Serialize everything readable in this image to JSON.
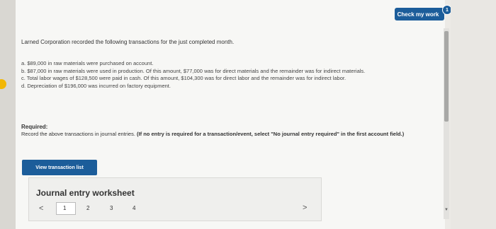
{
  "header": {
    "check_label": "Check my work",
    "check_badge": "1"
  },
  "intro": "Larned Corporation recorded the following transactions for the just completed month.",
  "transactions": [
    "a. $89,000 in raw materials were purchased on account.",
    "b. $87,000 in raw materials were used in production. Of this amount, $77,000 was for direct materials and the remainder was for indirect materials.",
    "c. Total labor wages of $128,500 were paid in cash. Of this amount, $104,300 was for direct labor and the remainder was for indirect labor.",
    "d. Depreciation of $196,000 was incurred on factory equipment."
  ],
  "required": {
    "heading": "Required:",
    "text": "Record the above transactions in journal entries.",
    "note": "(If no entry is required for a transaction/event, select \"No journal entry required\" in the first account field.)"
  },
  "view_button_label": "View transaction list",
  "worksheet": {
    "title": "Journal entry worksheet",
    "prev": "<",
    "next": ">",
    "pages": [
      "1",
      "2",
      "3",
      "4"
    ]
  },
  "colors": {
    "accent": "#1c5d9a",
    "indicator": "#f2b705"
  }
}
